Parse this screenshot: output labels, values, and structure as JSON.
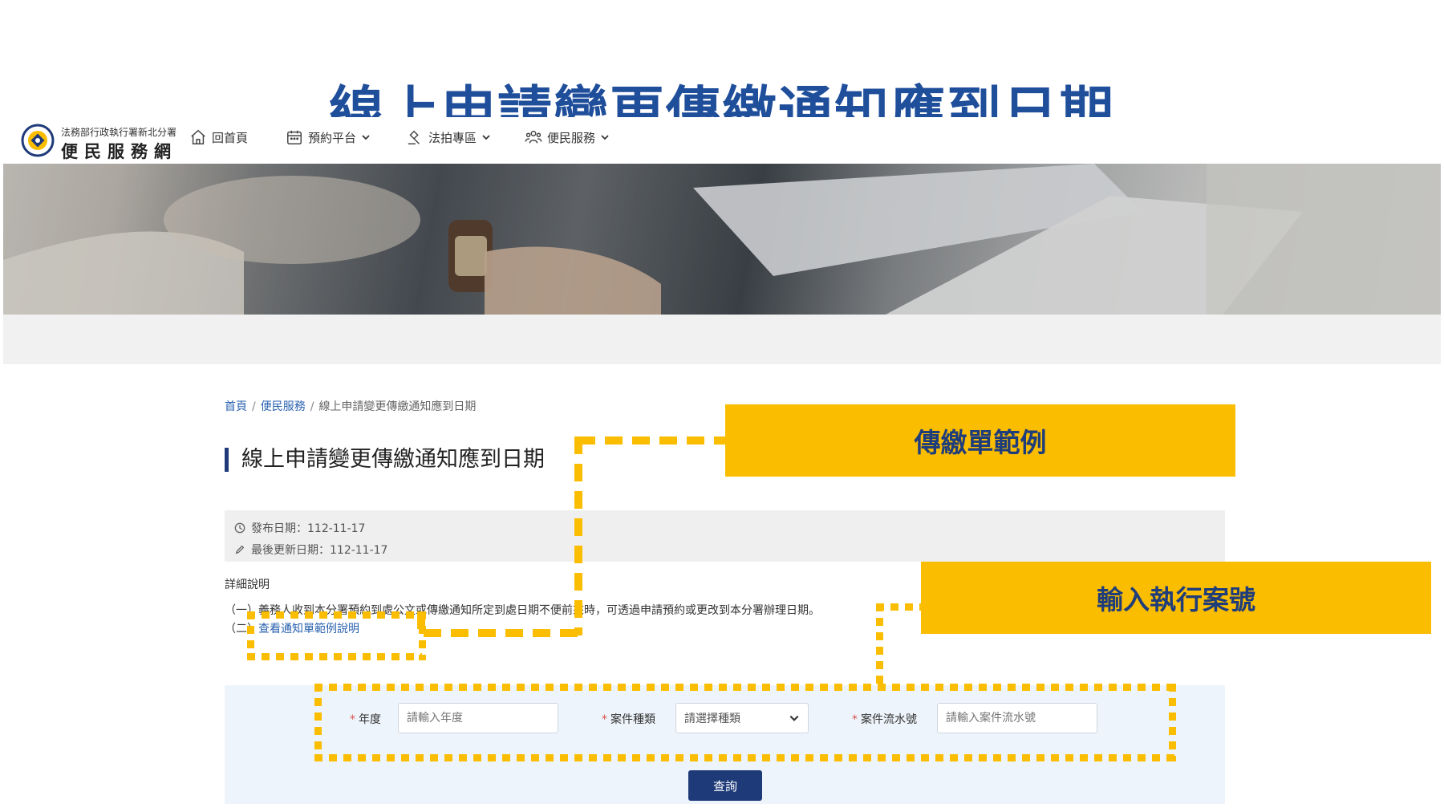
{
  "slide": {
    "title": "線上申請變更傳繳通知應到日期"
  },
  "header": {
    "logo_small": "法務部行政執行署新北分署",
    "logo_big": "便民服務網",
    "nav": [
      {
        "label": "回首頁",
        "icon": "home-icon"
      },
      {
        "label": "預約平台",
        "icon": "calendar-icon"
      },
      {
        "label": "法拍專區",
        "icon": "auction-hammer-icon"
      },
      {
        "label": "便民服務",
        "icon": "users-icon"
      }
    ]
  },
  "breadcrumb": {
    "home": "首頁",
    "service": "便民服務",
    "current": "線上申請變更傳繳通知應到日期",
    "separator": "/"
  },
  "page": {
    "title": "線上申請變更傳繳通知應到日期"
  },
  "meta": {
    "published": "發布日期：112-11-17",
    "updated": "最後更新日期：112-11-17"
  },
  "details": {
    "heading": "詳細說明",
    "line1": "（一）義務人收到本分署預約到處公文或傳繳通知所定到處日期不便前來時，可透過申請預約或更改到本分署辦理日期。",
    "line2_prefix": "（二）",
    "line2_link": "查看通知單範例說明"
  },
  "form": {
    "year_label": "年度",
    "year_placeholder": "請輸入年度",
    "type_label": "案件種類",
    "type_selected": "請選擇種類",
    "serial_label": "案件流水號",
    "serial_placeholder": "請輸入案件流水號",
    "required_mark": "*",
    "submit": "查詢"
  },
  "callouts": {
    "sample": "傳繳單範例",
    "case_no": "輸入執行案號"
  },
  "colors": {
    "accent": "#fbbd00",
    "title_blue": "#1f4e9b",
    "navy": "#1e3a78",
    "link": "#2a62b0"
  }
}
